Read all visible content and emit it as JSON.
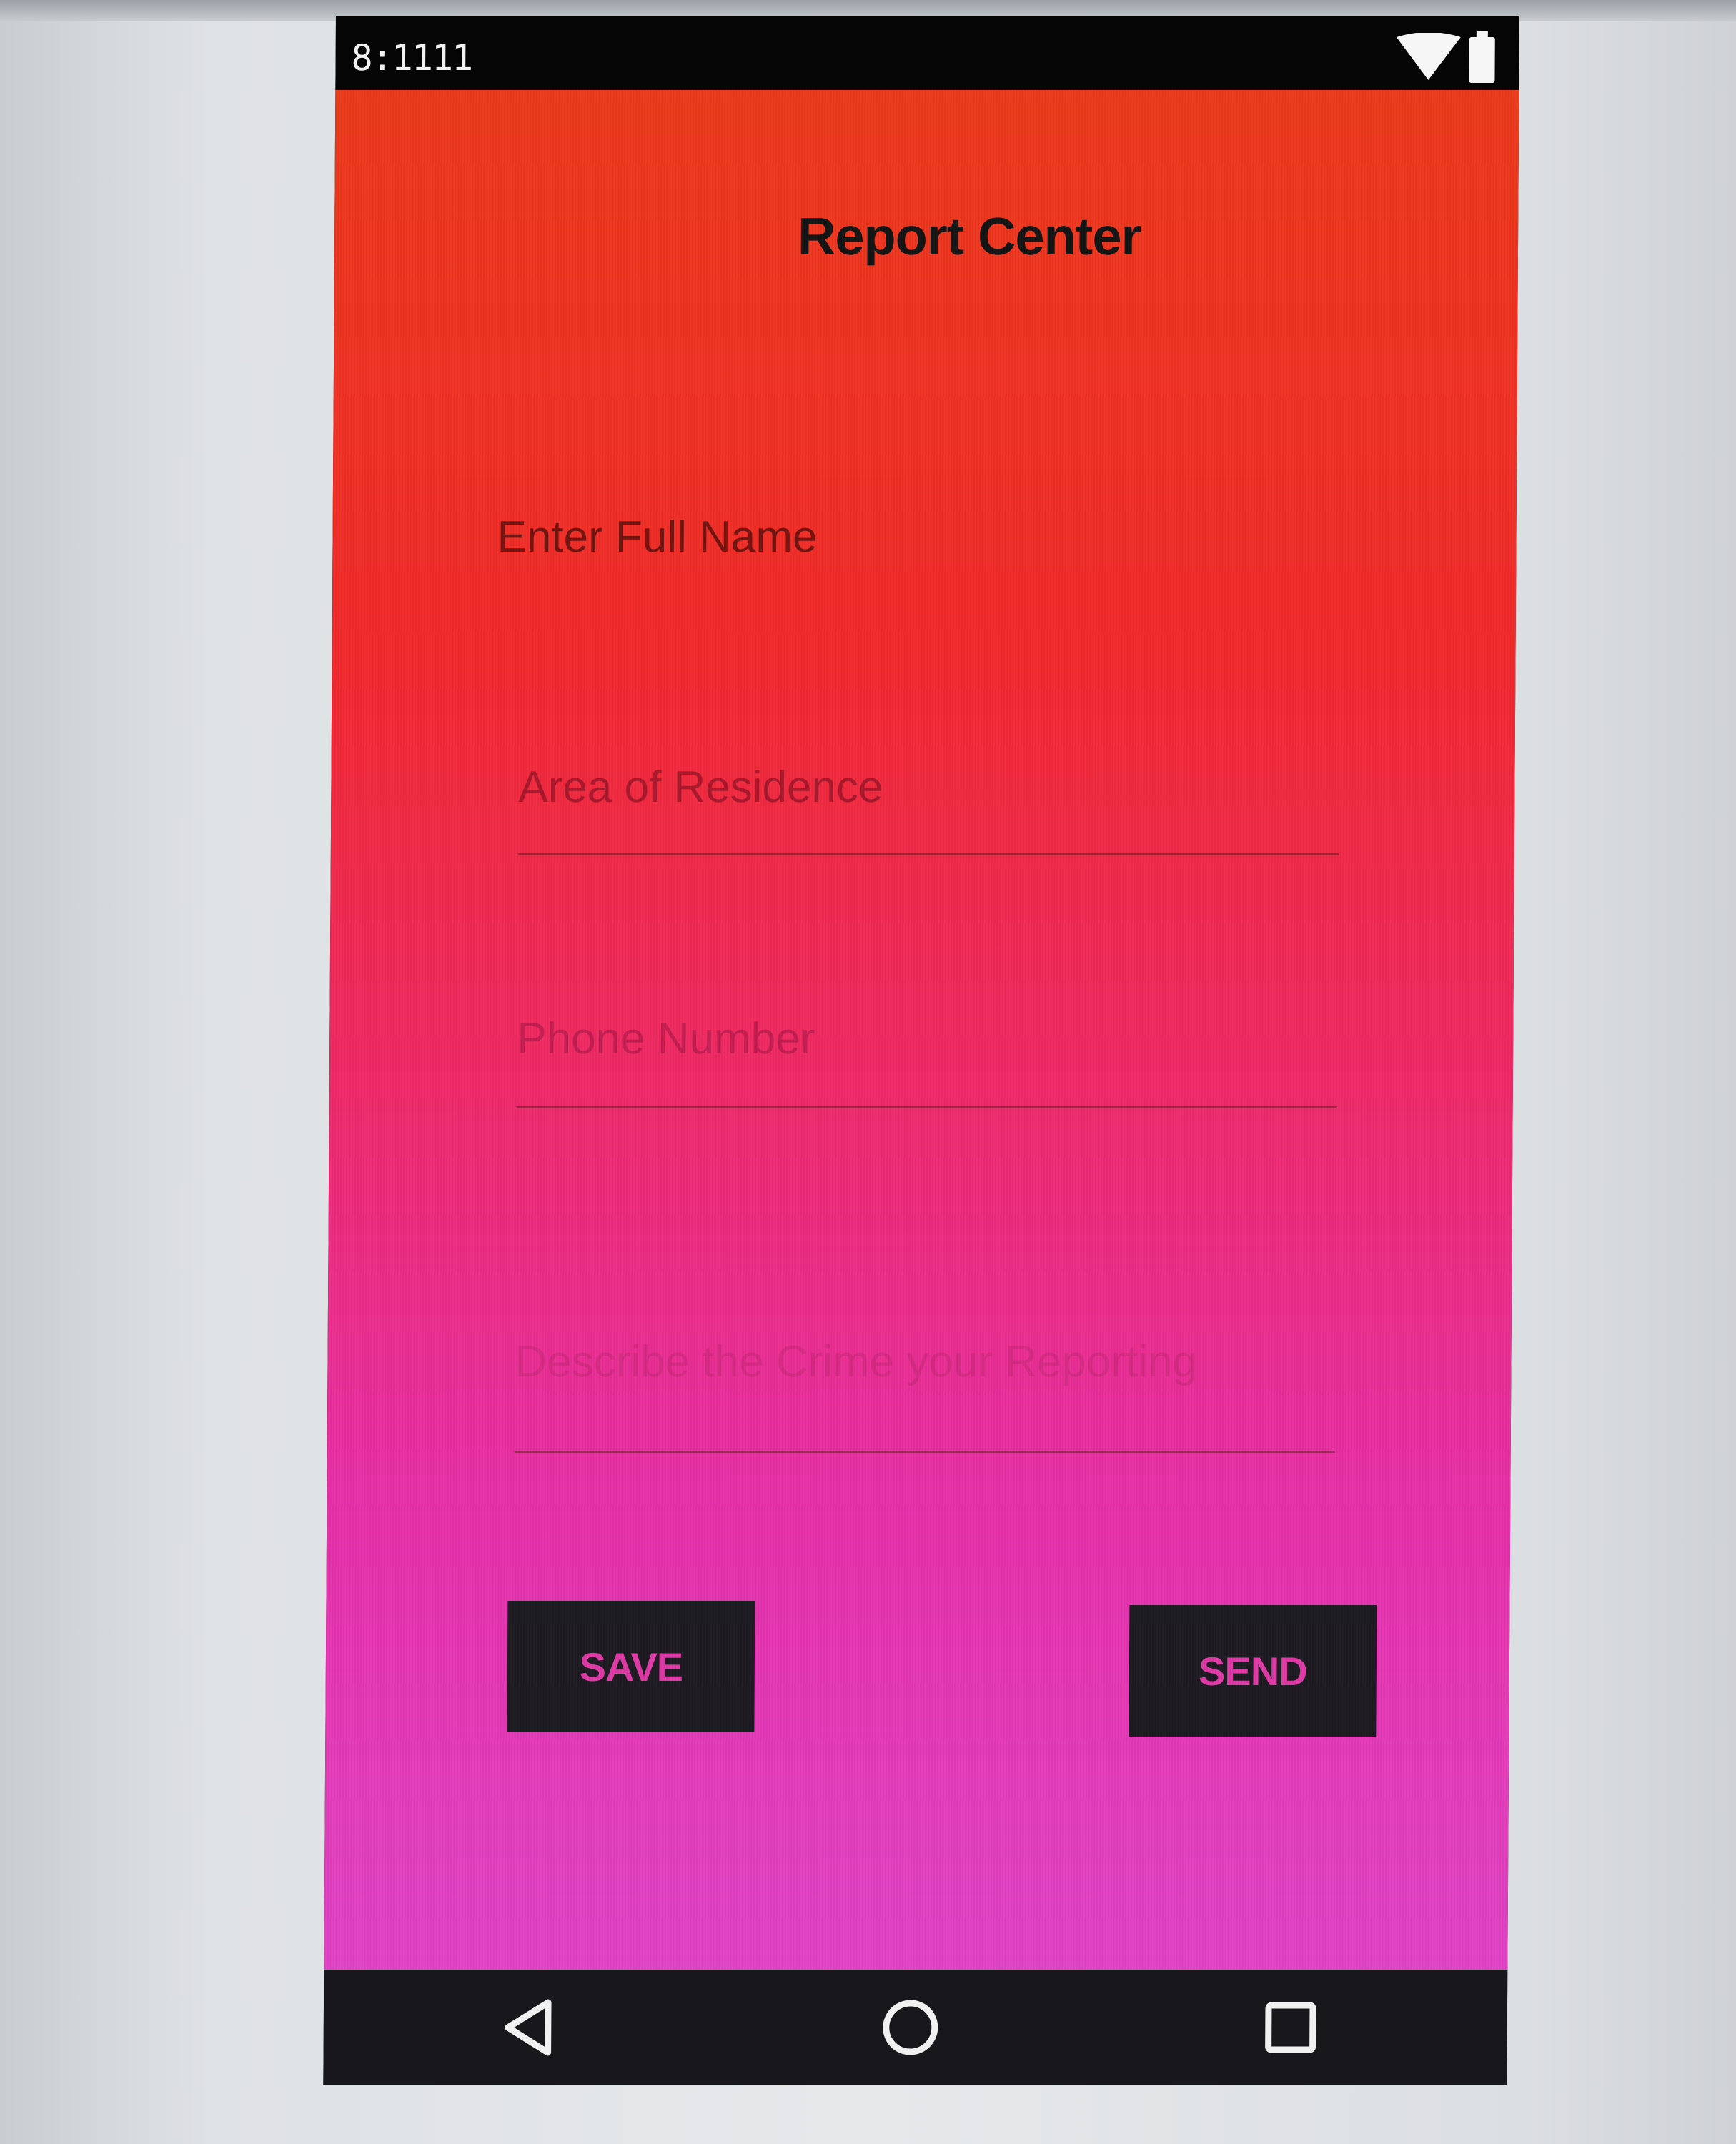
{
  "status_bar": {
    "time": "8:1111"
  },
  "icons": {
    "wifi": "wifi-icon",
    "battery": "battery-icon",
    "back": "back-triangle-icon",
    "home": "home-circle-icon",
    "recents": "recents-square-icon"
  },
  "screen": {
    "title": "Report Center",
    "fields": {
      "full_name_placeholder": "Enter Full Name",
      "residence_placeholder": "Area of Residence",
      "phone_placeholder": "Phone Number",
      "crime_placeholder": "Describe the Crime your Reporting"
    },
    "buttons": {
      "save_label": "SAVE",
      "send_label": "SEND"
    }
  },
  "colors": {
    "gradient_top": "#ef3b1a",
    "gradient_mid": "#f22a67",
    "gradient_bottom": "#e345c8",
    "button_bg": "#1d1a22",
    "button_text": "#e23aa8"
  }
}
